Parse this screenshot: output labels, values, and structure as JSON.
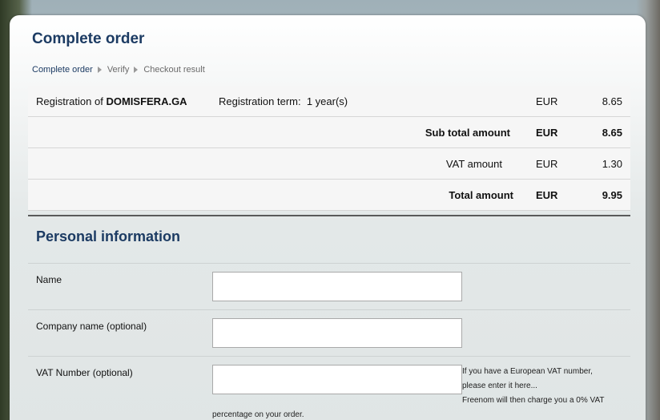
{
  "page": {
    "title": "Complete order",
    "breadcrumb": [
      "Complete order",
      "Verify",
      "Checkout result"
    ]
  },
  "order": {
    "item": {
      "prefix": "Registration of",
      "domain": "DOMISFERA.GA",
      "term_label": "Registration term:",
      "term_value": "1 year(s)",
      "currency": "EUR",
      "amount": "8.65"
    },
    "subtotal": {
      "label": "Sub total amount",
      "currency": "EUR",
      "amount": "8.65"
    },
    "vat": {
      "label": "VAT amount",
      "currency": "EUR",
      "amount": "1.30"
    },
    "total": {
      "label": "Total amount",
      "currency": "EUR",
      "amount": "9.95"
    }
  },
  "personal": {
    "title": "Personal information",
    "fields": {
      "name": {
        "label": "Name",
        "value": ""
      },
      "company": {
        "label": "Company name (optional)",
        "value": ""
      },
      "vat": {
        "label": "VAT Number (optional)",
        "value": "",
        "help_line1": "If you have a European VAT number,",
        "help_line2": "please enter it here...",
        "help_line3": "Freenom will then charge you a 0% VAT",
        "help_line4": "percentage on your order."
      }
    }
  }
}
